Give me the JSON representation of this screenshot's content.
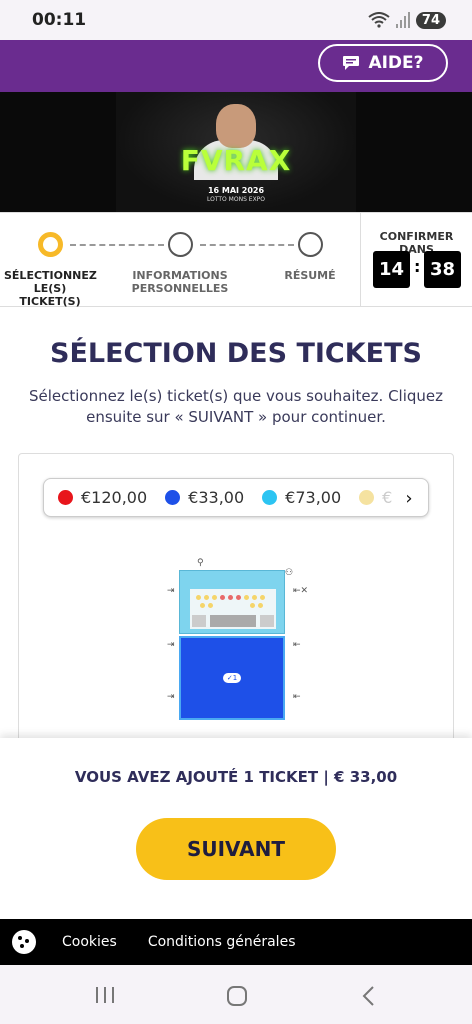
{
  "status_bar": {
    "time": "00:11",
    "battery": "74",
    "wifi_icon": "wifi-icon",
    "signal_icon": "signal-icon"
  },
  "header": {
    "help_label": "AIDE?",
    "help_icon": "chat-bubble-icon",
    "bg_color": "#6a2c8f"
  },
  "banner": {
    "artist": "FVRAX",
    "date": "16 MAI 2026",
    "venue": "LOTTO MONS EXPO"
  },
  "steps": [
    {
      "label": "SÉLECTIONNEZ LE(S) TICKET(S)",
      "state": "active"
    },
    {
      "label": "INFORMATIONS PERSONNELLES",
      "state": "pending"
    },
    {
      "label": "RÉSUMÉ",
      "state": "pending"
    }
  ],
  "confirm": {
    "label": "CONFIRMER DANS",
    "minutes": "14",
    "seconds": "38",
    "separator": ":"
  },
  "main": {
    "title": "SÉLECTION DES TICKETS",
    "subtitle": "Sélectionnez le(s) ticket(s) que vous souhaitez. Cliquez ensuite sur « SUIVANT » pour continuer."
  },
  "prices": [
    {
      "label": "€120,00",
      "color": "#e8151b"
    },
    {
      "label": "€33,00",
      "color": "#1e50e8"
    },
    {
      "label": "€73,00",
      "color": "#2cc4f2"
    },
    {
      "label": "€",
      "color": "#f5e2a0"
    }
  ],
  "map": {
    "floor_badge": "✓1"
  },
  "footer": {
    "added_text": "VOUS AVEZ AJOUTÉ 1 TICKET | € 33,00",
    "next_label": "SUIVANT",
    "next_color": "#f8c018"
  },
  "cookie_bar": {
    "cookies_label": "Cookies",
    "terms_label": "Conditions générales"
  }
}
